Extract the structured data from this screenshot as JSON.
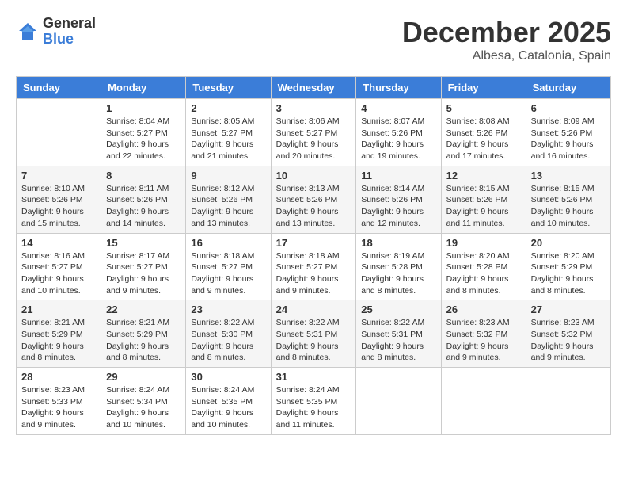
{
  "logo": {
    "general": "General",
    "blue": "Blue"
  },
  "header": {
    "month": "December 2025",
    "location": "Albesa, Catalonia, Spain"
  },
  "weekdays": [
    "Sunday",
    "Monday",
    "Tuesday",
    "Wednesday",
    "Thursday",
    "Friday",
    "Saturday"
  ],
  "weeks": [
    [
      {
        "day": "",
        "info": ""
      },
      {
        "day": "1",
        "info": "Sunrise: 8:04 AM\nSunset: 5:27 PM\nDaylight: 9 hours\nand 22 minutes."
      },
      {
        "day": "2",
        "info": "Sunrise: 8:05 AM\nSunset: 5:27 PM\nDaylight: 9 hours\nand 21 minutes."
      },
      {
        "day": "3",
        "info": "Sunrise: 8:06 AM\nSunset: 5:27 PM\nDaylight: 9 hours\nand 20 minutes."
      },
      {
        "day": "4",
        "info": "Sunrise: 8:07 AM\nSunset: 5:26 PM\nDaylight: 9 hours\nand 19 minutes."
      },
      {
        "day": "5",
        "info": "Sunrise: 8:08 AM\nSunset: 5:26 PM\nDaylight: 9 hours\nand 17 minutes."
      },
      {
        "day": "6",
        "info": "Sunrise: 8:09 AM\nSunset: 5:26 PM\nDaylight: 9 hours\nand 16 minutes."
      }
    ],
    [
      {
        "day": "7",
        "info": "Sunrise: 8:10 AM\nSunset: 5:26 PM\nDaylight: 9 hours\nand 15 minutes."
      },
      {
        "day": "8",
        "info": "Sunrise: 8:11 AM\nSunset: 5:26 PM\nDaylight: 9 hours\nand 14 minutes."
      },
      {
        "day": "9",
        "info": "Sunrise: 8:12 AM\nSunset: 5:26 PM\nDaylight: 9 hours\nand 13 minutes."
      },
      {
        "day": "10",
        "info": "Sunrise: 8:13 AM\nSunset: 5:26 PM\nDaylight: 9 hours\nand 13 minutes."
      },
      {
        "day": "11",
        "info": "Sunrise: 8:14 AM\nSunset: 5:26 PM\nDaylight: 9 hours\nand 12 minutes."
      },
      {
        "day": "12",
        "info": "Sunrise: 8:15 AM\nSunset: 5:26 PM\nDaylight: 9 hours\nand 11 minutes."
      },
      {
        "day": "13",
        "info": "Sunrise: 8:15 AM\nSunset: 5:26 PM\nDaylight: 9 hours\nand 10 minutes."
      }
    ],
    [
      {
        "day": "14",
        "info": "Sunrise: 8:16 AM\nSunset: 5:27 PM\nDaylight: 9 hours\nand 10 minutes."
      },
      {
        "day": "15",
        "info": "Sunrise: 8:17 AM\nSunset: 5:27 PM\nDaylight: 9 hours\nand 9 minutes."
      },
      {
        "day": "16",
        "info": "Sunrise: 8:18 AM\nSunset: 5:27 PM\nDaylight: 9 hours\nand 9 minutes."
      },
      {
        "day": "17",
        "info": "Sunrise: 8:18 AM\nSunset: 5:27 PM\nDaylight: 9 hours\nand 9 minutes."
      },
      {
        "day": "18",
        "info": "Sunrise: 8:19 AM\nSunset: 5:28 PM\nDaylight: 9 hours\nand 8 minutes."
      },
      {
        "day": "19",
        "info": "Sunrise: 8:20 AM\nSunset: 5:28 PM\nDaylight: 9 hours\nand 8 minutes."
      },
      {
        "day": "20",
        "info": "Sunrise: 8:20 AM\nSunset: 5:29 PM\nDaylight: 9 hours\nand 8 minutes."
      }
    ],
    [
      {
        "day": "21",
        "info": "Sunrise: 8:21 AM\nSunset: 5:29 PM\nDaylight: 9 hours\nand 8 minutes."
      },
      {
        "day": "22",
        "info": "Sunrise: 8:21 AM\nSunset: 5:29 PM\nDaylight: 9 hours\nand 8 minutes."
      },
      {
        "day": "23",
        "info": "Sunrise: 8:22 AM\nSunset: 5:30 PM\nDaylight: 9 hours\nand 8 minutes."
      },
      {
        "day": "24",
        "info": "Sunrise: 8:22 AM\nSunset: 5:31 PM\nDaylight: 9 hours\nand 8 minutes."
      },
      {
        "day": "25",
        "info": "Sunrise: 8:22 AM\nSunset: 5:31 PM\nDaylight: 9 hours\nand 8 minutes."
      },
      {
        "day": "26",
        "info": "Sunrise: 8:23 AM\nSunset: 5:32 PM\nDaylight: 9 hours\nand 9 minutes."
      },
      {
        "day": "27",
        "info": "Sunrise: 8:23 AM\nSunset: 5:32 PM\nDaylight: 9 hours\nand 9 minutes."
      }
    ],
    [
      {
        "day": "28",
        "info": "Sunrise: 8:23 AM\nSunset: 5:33 PM\nDaylight: 9 hours\nand 9 minutes."
      },
      {
        "day": "29",
        "info": "Sunrise: 8:24 AM\nSunset: 5:34 PM\nDaylight: 9 hours\nand 10 minutes."
      },
      {
        "day": "30",
        "info": "Sunrise: 8:24 AM\nSunset: 5:35 PM\nDaylight: 9 hours\nand 10 minutes."
      },
      {
        "day": "31",
        "info": "Sunrise: 8:24 AM\nSunset: 5:35 PM\nDaylight: 9 hours\nand 11 minutes."
      },
      {
        "day": "",
        "info": ""
      },
      {
        "day": "",
        "info": ""
      },
      {
        "day": "",
        "info": ""
      }
    ]
  ]
}
